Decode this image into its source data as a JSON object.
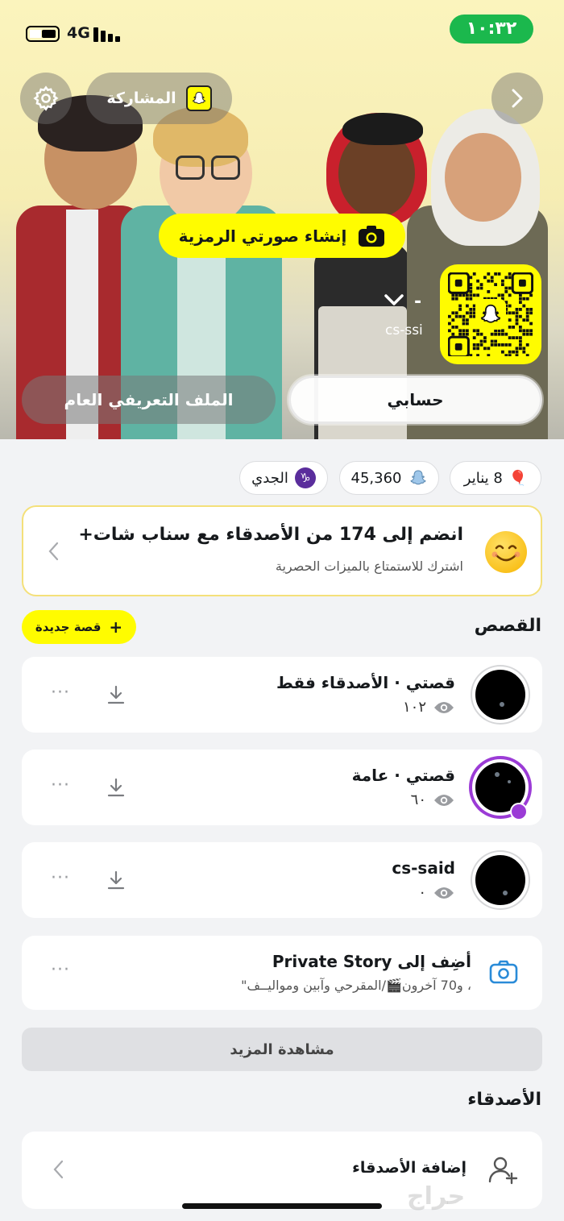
{
  "status_bar": {
    "network": "4G",
    "time": "١٠:٣٢"
  },
  "header": {
    "share_label": "المشاركة",
    "create_bitmoji_label": "إنشاء صورتي الرمزية",
    "display_name": "-",
    "username": "cs-ssi",
    "tabs": {
      "public_profile": "الملف التعريفي العام",
      "my_account": "حسابي"
    }
  },
  "badges": {
    "birthday": "8 يناير",
    "snap_score": "45,360",
    "zodiac": "الجدي",
    "zodiac_symbol": "♑"
  },
  "snapchat_plus": {
    "title": "انضم إلى 174 من الأصدقاء مع سناب شات+",
    "subtitle": "اشترك للاستمتاع بالميزات الحصرية"
  },
  "stories": {
    "section_title": "القصص",
    "new_story_label": "قصة جديدة",
    "items": [
      {
        "title": "قصتي · الأصدقاء فقط",
        "views": "١٠٢"
      },
      {
        "title": "قصتي · عامة",
        "views": "٦٠"
      },
      {
        "title": "cs-said",
        "views": "٠"
      }
    ],
    "private": {
      "title": "أضِف إلى Private Story",
      "subtitle": "، و70 آخرون🎬/المقرحي وآبين ومواليــف\""
    },
    "see_more": "مشاهدة المزيد"
  },
  "friends": {
    "section_title": "الأصدقاء",
    "add_friends_label": "إضافة الأصدقاء"
  },
  "watermark": "حراج",
  "colors": {
    "snap_yellow": "#fffc00",
    "status_green": "#1bb84d",
    "purple_ring": "#9b3bd6",
    "icon_blue": "#2a8bd8"
  }
}
